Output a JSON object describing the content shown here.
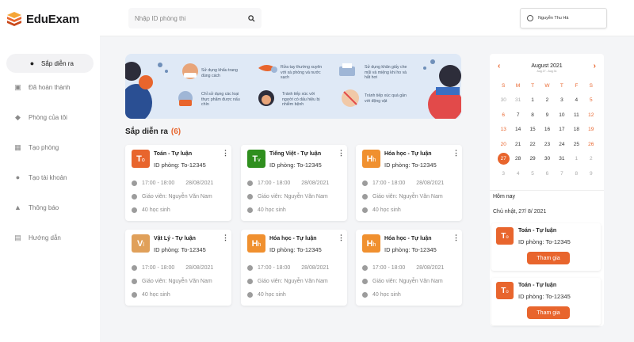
{
  "logo": {
    "text": "EduExam"
  },
  "search": {
    "placeholder": "Nhập ID phòng thi"
  },
  "user": {
    "name": "Nguyễn Thu Hà"
  },
  "nav": [
    {
      "label": "Sắp diễn ra",
      "icon": "clock-icon",
      "active": true
    },
    {
      "label": "Đã hoàn thành",
      "icon": "briefcase-icon"
    },
    {
      "label": "Phòng của tôi",
      "icon": "graduation-cap-icon"
    },
    {
      "label": "Tạo phòng",
      "icon": "grid-icon"
    },
    {
      "label": "Tạo tài khoản",
      "icon": "user-icon"
    },
    {
      "label": "Thông báo",
      "icon": "bell-icon"
    },
    {
      "label": "Hướng dẫn",
      "icon": "database-icon"
    }
  ],
  "banner": {
    "items": [
      "Sử dụng khẩu trang đúng cách",
      "Rửa tay thường xuyên với xà phòng và nước sạch",
      "Sử dụng khăn giấy che mũi và miệng khi ho và hắt hơi",
      "Chỉ sử dụng các loại thực phẩm được nấu chín",
      "Tránh tiếp xúc với người có dấu hiệu bị nhiễm bệnh",
      "Tránh tiếp xúc quá gần với động vật"
    ]
  },
  "section": {
    "title": "Sắp diễn ra",
    "count": "(6)"
  },
  "colors": {
    "accent": "#e8652d",
    "green": "#2f8f1e",
    "amber": "#e0a05a"
  },
  "cards": [
    {
      "letter": "T",
      "sub": "o",
      "color": "#e8652d",
      "title": "Toán - Tự luận",
      "room": "ID phòng: To-12345",
      "time": "17:00 - 18:00",
      "date": "28/08/2021",
      "teacher": "Giáo viên: Nguyễn Văn Nam",
      "students": "40 học sinh"
    },
    {
      "letter": "T",
      "sub": "v",
      "color": "#2f8f1e",
      "title": "Tiếng Việt - Tự luận",
      "room": "ID phòng: To-12345",
      "time": "17:00 - 18:00",
      "date": "28/08/2021",
      "teacher": "Giáo viên: Nguyễn Văn Nam",
      "students": "40 học sinh"
    },
    {
      "letter": "H",
      "sub": "h",
      "color": "#f0902f",
      "title": "Hóa học - Tự luận",
      "room": "ID phòng: To-12345",
      "time": "17:00 - 18:00",
      "date": "28/08/2021",
      "teacher": "Giáo viên: Nguyễn Văn Nam",
      "students": "40 học sinh"
    },
    {
      "letter": "V",
      "sub": "l",
      "color": "#e0a05a",
      "title": "Vật Lý - Tự luận",
      "room": "ID phòng: To-12345",
      "time": "17:00 - 18:00",
      "date": "28/08/2021",
      "teacher": "Giáo viên: Nguyễn Văn Nam",
      "students": "40 học sinh"
    },
    {
      "letter": "H",
      "sub": "h",
      "color": "#f0902f",
      "title": "Hóa học - Tự luận",
      "room": "ID phòng: To-12345",
      "time": "17:00 - 18:00",
      "date": "28/08/2021",
      "teacher": "Giáo viên: Nguyễn Văn Nam",
      "students": "40 học sinh"
    },
    {
      "letter": "H",
      "sub": "h",
      "color": "#f0902f",
      "title": "Hóa học - Tự luận",
      "room": "ID phòng: To-12345",
      "time": "17:00 - 18:00",
      "date": "28/08/2021",
      "teacher": "Giáo viên: Nguyễn Văn Nam",
      "students": "40 học sinh"
    }
  ],
  "calendar": {
    "month": "August 2021",
    "range": "Aug 27 - Aug 31",
    "weekdays": [
      "S",
      "M",
      "T",
      "W",
      "T",
      "F",
      "S"
    ],
    "days": [
      [
        "30",
        "31",
        "1",
        "2",
        "3",
        "4",
        "5"
      ],
      [
        "6",
        "7",
        "8",
        "9",
        "10",
        "11",
        "12"
      ],
      [
        "13",
        "14",
        "15",
        "16",
        "17",
        "18",
        "19"
      ],
      [
        "20",
        "21",
        "22",
        "23",
        "24",
        "25",
        "26"
      ],
      [
        "27",
        "28",
        "29",
        "30",
        "31",
        "1",
        "2"
      ],
      [
        "3",
        "4",
        "5",
        "6",
        "7",
        "8",
        "9"
      ]
    ],
    "today": "27"
  },
  "today": {
    "title": "Hôm nay",
    "date": "Chủ nhật, 27/ 8/ 2021",
    "items": [
      {
        "letter": "T",
        "sub": "o",
        "title": "Toán - Tự luận",
        "room": "ID phòng: To-12345",
        "button": "Tham gia"
      },
      {
        "letter": "T",
        "sub": "o",
        "title": "Toán - Tự luận",
        "room": "ID phòng: To-12345",
        "button": "Tham gia"
      }
    ]
  }
}
